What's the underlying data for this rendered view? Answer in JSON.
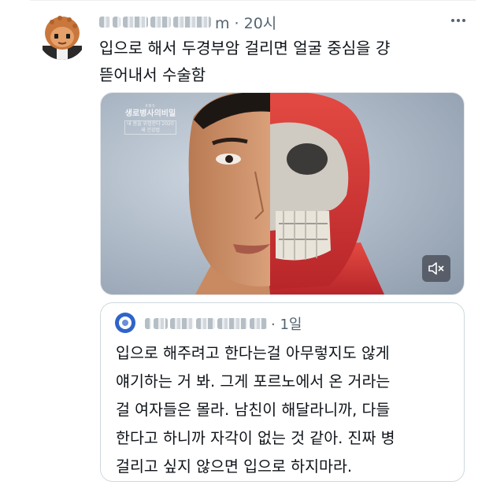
{
  "post": {
    "time": "m · 20시",
    "text": "입으로 해서 두경부암 걸리면 얼굴 중심을 걍\n뜯어내서 수술함",
    "more_icon": "more-horizontal-icon",
    "avatar": "cartoon-avatar"
  },
  "video": {
    "watermark_small": "KBS",
    "watermark_title": "생로병사의비밀",
    "watermark_sub": "내 몸을 위협한다 2020 새 건강법",
    "mute_icon": "speaker-muted-icon"
  },
  "quote": {
    "time": "· 1일",
    "text": "입으로 해주려고 한다는걸 아무렇지도 않게\n얘기하는 거 봐. 그게 포르노에서 온 거라는\n걸 여자들은 몰라. 남친이 해달라니까, 다들\n한다고 하니까 자각이 없는 것 같아. 진짜 병\n걸리고 싶지 않으면 입으로 하지마라."
  },
  "colors": {
    "text": "#0f1419",
    "secondary": "#536471",
    "border": "#cfd9de"
  }
}
